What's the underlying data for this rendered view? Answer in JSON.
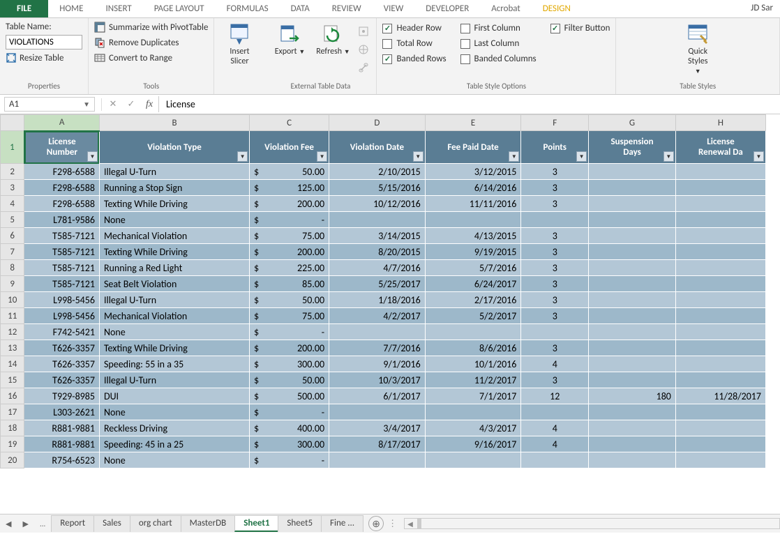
{
  "ribbon": {
    "tabs": [
      "FILE",
      "HOME",
      "INSERT",
      "PAGE LAYOUT",
      "FORMULAS",
      "DATA",
      "REVIEW",
      "VIEW",
      "DEVELOPER",
      "Acrobat",
      "DESIGN"
    ],
    "user": "JD Sar",
    "properties": {
      "label": "Properties",
      "table_name_label": "Table Name:",
      "table_name_value": "VIOLATIONS",
      "resize_table": "Resize Table"
    },
    "tools": {
      "label": "Tools",
      "summarize": "Summarize with PivotTable",
      "remove_dup": "Remove Duplicates",
      "convert": "Convert to Range"
    },
    "insert_slicer": "Insert\nSlicer",
    "external": {
      "label": "External Table Data",
      "export": "Export",
      "refresh": "Refresh"
    },
    "style_options": {
      "label": "Table Style Options",
      "header_row": "Header Row",
      "total_row": "Total Row",
      "banded_rows": "Banded Rows",
      "first_col": "First Column",
      "last_col": "Last Column",
      "banded_cols": "Banded Columns",
      "filter_btn": "Filter Button"
    },
    "table_styles": {
      "label": "Table Styles",
      "quick": "Quick\nStyles"
    }
  },
  "formula_bar": {
    "name_box": "A1",
    "value": "License"
  },
  "columns": [
    "A",
    "B",
    "C",
    "D",
    "E",
    "F",
    "G",
    "H"
  ],
  "headers": [
    "License Number",
    "Violation Type",
    "Violation Fee",
    "Violation Date",
    "Fee Paid Date",
    "Points",
    "Suspension Days",
    "License Renewal Da"
  ],
  "rows": [
    {
      "n": 2,
      "a": "F298-6588",
      "b": "Illegal U-Turn",
      "c": "50.00",
      "d": "2/10/2015",
      "e": "3/12/2015",
      "f": "3",
      "g": "",
      "h": ""
    },
    {
      "n": 3,
      "a": "F298-6588",
      "b": "Running a Stop Sign",
      "c": "125.00",
      "d": "5/15/2016",
      "e": "6/14/2016",
      "f": "3",
      "g": "",
      "h": ""
    },
    {
      "n": 4,
      "a": "F298-6588",
      "b": "Texting While Driving",
      "c": "200.00",
      "d": "10/12/2016",
      "e": "11/11/2016",
      "f": "3",
      "g": "",
      "h": ""
    },
    {
      "n": 5,
      "a": "L781-9586",
      "b": "None",
      "c": "-",
      "d": "",
      "e": "",
      "f": "",
      "g": "",
      "h": ""
    },
    {
      "n": 6,
      "a": "T585-7121",
      "b": "Mechanical Violation",
      "c": "75.00",
      "d": "3/14/2015",
      "e": "4/13/2015",
      "f": "3",
      "g": "",
      "h": ""
    },
    {
      "n": 7,
      "a": "T585-7121",
      "b": "Texting While Driving",
      "c": "200.00",
      "d": "8/20/2015",
      "e": "9/19/2015",
      "f": "3",
      "g": "",
      "h": ""
    },
    {
      "n": 8,
      "a": "T585-7121",
      "b": "Running a Red Light",
      "c": "225.00",
      "d": "4/7/2016",
      "e": "5/7/2016",
      "f": "3",
      "g": "",
      "h": ""
    },
    {
      "n": 9,
      "a": "T585-7121",
      "b": "Seat Belt Violation",
      "c": "85.00",
      "d": "5/25/2017",
      "e": "6/24/2017",
      "f": "3",
      "g": "",
      "h": ""
    },
    {
      "n": 10,
      "a": "L998-5456",
      "b": "Illegal U-Turn",
      "c": "50.00",
      "d": "1/18/2016",
      "e": "2/17/2016",
      "f": "3",
      "g": "",
      "h": ""
    },
    {
      "n": 11,
      "a": "L998-5456",
      "b": "Mechanical Violation",
      "c": "75.00",
      "d": "4/2/2017",
      "e": "5/2/2017",
      "f": "3",
      "g": "",
      "h": ""
    },
    {
      "n": 12,
      "a": "F742-5421",
      "b": "None",
      "c": "-",
      "d": "",
      "e": "",
      "f": "",
      "g": "",
      "h": ""
    },
    {
      "n": 13,
      "a": "T626-3357",
      "b": "Texting While Driving",
      "c": "200.00",
      "d": "7/7/2016",
      "e": "8/6/2016",
      "f": "3",
      "g": "",
      "h": ""
    },
    {
      "n": 14,
      "a": "T626-3357",
      "b": "Speeding: 55 in a 35",
      "c": "300.00",
      "d": "9/1/2016",
      "e": "10/1/2016",
      "f": "4",
      "g": "",
      "h": ""
    },
    {
      "n": 15,
      "a": "T626-3357",
      "b": "Illegal U-Turn",
      "c": "50.00",
      "d": "10/3/2017",
      "e": "11/2/2017",
      "f": "3",
      "g": "",
      "h": ""
    },
    {
      "n": 16,
      "a": "T929-8985",
      "b": "DUI",
      "c": "500.00",
      "d": "6/1/2017",
      "e": "7/1/2017",
      "f": "12",
      "g": "180",
      "h": "11/28/2017"
    },
    {
      "n": 17,
      "a": "L303-2621",
      "b": "None",
      "c": "-",
      "d": "",
      "e": "",
      "f": "",
      "g": "",
      "h": ""
    },
    {
      "n": 18,
      "a": "R881-9881",
      "b": "Reckless Driving",
      "c": "400.00",
      "d": "3/4/2017",
      "e": "4/3/2017",
      "f": "4",
      "g": "",
      "h": ""
    },
    {
      "n": 19,
      "a": "R881-9881",
      "b": "Speeding: 45 in a 25",
      "c": "300.00",
      "d": "8/17/2017",
      "e": "9/16/2017",
      "f": "4",
      "g": "",
      "h": ""
    },
    {
      "n": 20,
      "a": "R754-6523",
      "b": "None",
      "c": "-",
      "d": "",
      "e": "",
      "f": "",
      "g": "",
      "h": ""
    }
  ],
  "sheet_tabs": {
    "items": [
      "Report",
      "Sales",
      "org chart",
      "MasterDB",
      "Sheet1",
      "Sheet5",
      "Fine ..."
    ],
    "active": "Sheet1",
    "ellipsis": "..."
  }
}
